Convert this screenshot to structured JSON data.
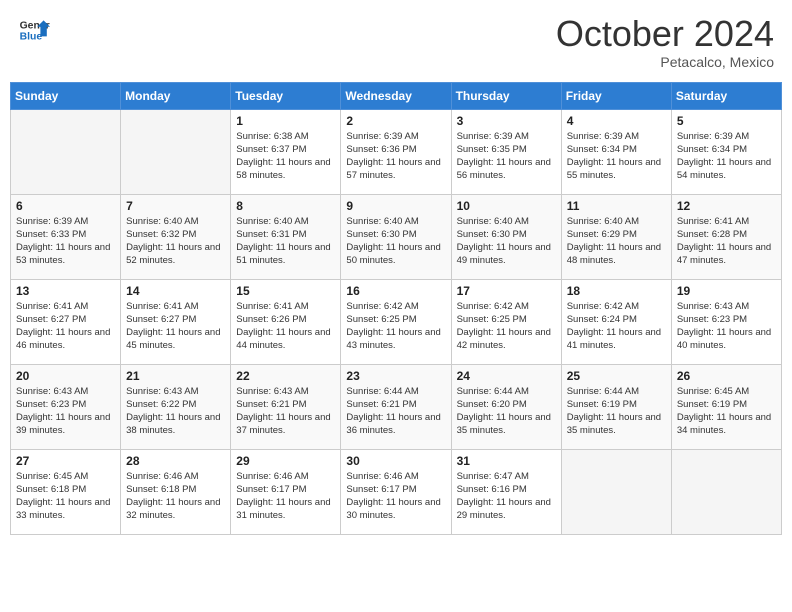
{
  "header": {
    "logo": {
      "general": "General",
      "blue": "Blue"
    },
    "month": "October 2024",
    "location": "Petacalco, Mexico"
  },
  "weekdays": [
    "Sunday",
    "Monday",
    "Tuesday",
    "Wednesday",
    "Thursday",
    "Friday",
    "Saturday"
  ],
  "weeks": [
    [
      {
        "day": "",
        "info": ""
      },
      {
        "day": "",
        "info": ""
      },
      {
        "day": "1",
        "info": "Sunrise: 6:38 AM\nSunset: 6:37 PM\nDaylight: 11 hours and 58 minutes."
      },
      {
        "day": "2",
        "info": "Sunrise: 6:39 AM\nSunset: 6:36 PM\nDaylight: 11 hours and 57 minutes."
      },
      {
        "day": "3",
        "info": "Sunrise: 6:39 AM\nSunset: 6:35 PM\nDaylight: 11 hours and 56 minutes."
      },
      {
        "day": "4",
        "info": "Sunrise: 6:39 AM\nSunset: 6:34 PM\nDaylight: 11 hours and 55 minutes."
      },
      {
        "day": "5",
        "info": "Sunrise: 6:39 AM\nSunset: 6:34 PM\nDaylight: 11 hours and 54 minutes."
      }
    ],
    [
      {
        "day": "6",
        "info": "Sunrise: 6:39 AM\nSunset: 6:33 PM\nDaylight: 11 hours and 53 minutes."
      },
      {
        "day": "7",
        "info": "Sunrise: 6:40 AM\nSunset: 6:32 PM\nDaylight: 11 hours and 52 minutes."
      },
      {
        "day": "8",
        "info": "Sunrise: 6:40 AM\nSunset: 6:31 PM\nDaylight: 11 hours and 51 minutes."
      },
      {
        "day": "9",
        "info": "Sunrise: 6:40 AM\nSunset: 6:30 PM\nDaylight: 11 hours and 50 minutes."
      },
      {
        "day": "10",
        "info": "Sunrise: 6:40 AM\nSunset: 6:30 PM\nDaylight: 11 hours and 49 minutes."
      },
      {
        "day": "11",
        "info": "Sunrise: 6:40 AM\nSunset: 6:29 PM\nDaylight: 11 hours and 48 minutes."
      },
      {
        "day": "12",
        "info": "Sunrise: 6:41 AM\nSunset: 6:28 PM\nDaylight: 11 hours and 47 minutes."
      }
    ],
    [
      {
        "day": "13",
        "info": "Sunrise: 6:41 AM\nSunset: 6:27 PM\nDaylight: 11 hours and 46 minutes."
      },
      {
        "day": "14",
        "info": "Sunrise: 6:41 AM\nSunset: 6:27 PM\nDaylight: 11 hours and 45 minutes."
      },
      {
        "day": "15",
        "info": "Sunrise: 6:41 AM\nSunset: 6:26 PM\nDaylight: 11 hours and 44 minutes."
      },
      {
        "day": "16",
        "info": "Sunrise: 6:42 AM\nSunset: 6:25 PM\nDaylight: 11 hours and 43 minutes."
      },
      {
        "day": "17",
        "info": "Sunrise: 6:42 AM\nSunset: 6:25 PM\nDaylight: 11 hours and 42 minutes."
      },
      {
        "day": "18",
        "info": "Sunrise: 6:42 AM\nSunset: 6:24 PM\nDaylight: 11 hours and 41 minutes."
      },
      {
        "day": "19",
        "info": "Sunrise: 6:43 AM\nSunset: 6:23 PM\nDaylight: 11 hours and 40 minutes."
      }
    ],
    [
      {
        "day": "20",
        "info": "Sunrise: 6:43 AM\nSunset: 6:23 PM\nDaylight: 11 hours and 39 minutes."
      },
      {
        "day": "21",
        "info": "Sunrise: 6:43 AM\nSunset: 6:22 PM\nDaylight: 11 hours and 38 minutes."
      },
      {
        "day": "22",
        "info": "Sunrise: 6:43 AM\nSunset: 6:21 PM\nDaylight: 11 hours and 37 minutes."
      },
      {
        "day": "23",
        "info": "Sunrise: 6:44 AM\nSunset: 6:21 PM\nDaylight: 11 hours and 36 minutes."
      },
      {
        "day": "24",
        "info": "Sunrise: 6:44 AM\nSunset: 6:20 PM\nDaylight: 11 hours and 35 minutes."
      },
      {
        "day": "25",
        "info": "Sunrise: 6:44 AM\nSunset: 6:19 PM\nDaylight: 11 hours and 35 minutes."
      },
      {
        "day": "26",
        "info": "Sunrise: 6:45 AM\nSunset: 6:19 PM\nDaylight: 11 hours and 34 minutes."
      }
    ],
    [
      {
        "day": "27",
        "info": "Sunrise: 6:45 AM\nSunset: 6:18 PM\nDaylight: 11 hours and 33 minutes."
      },
      {
        "day": "28",
        "info": "Sunrise: 6:46 AM\nSunset: 6:18 PM\nDaylight: 11 hours and 32 minutes."
      },
      {
        "day": "29",
        "info": "Sunrise: 6:46 AM\nSunset: 6:17 PM\nDaylight: 11 hours and 31 minutes."
      },
      {
        "day": "30",
        "info": "Sunrise: 6:46 AM\nSunset: 6:17 PM\nDaylight: 11 hours and 30 minutes."
      },
      {
        "day": "31",
        "info": "Sunrise: 6:47 AM\nSunset: 6:16 PM\nDaylight: 11 hours and 29 minutes."
      },
      {
        "day": "",
        "info": ""
      },
      {
        "day": "",
        "info": ""
      }
    ]
  ]
}
